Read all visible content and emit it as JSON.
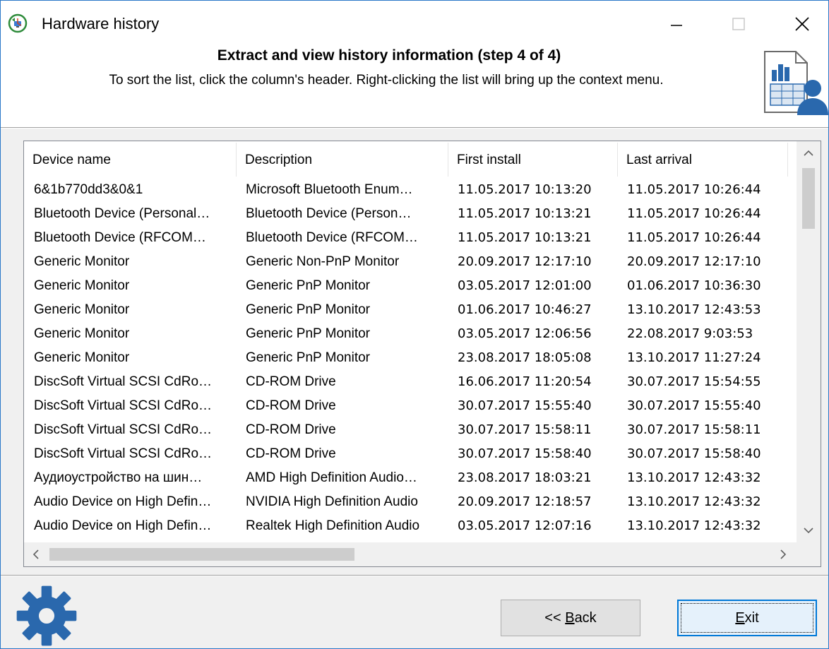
{
  "window": {
    "title": "Hardware history",
    "app_icon": "hardware-history-app-icon",
    "controls": [
      "minimize-icon",
      "maximize-icon",
      "close-icon"
    ]
  },
  "header": {
    "title": "Extract and view history information (step 4 of 4)",
    "subtitle": "To sort the list, click the column's header. Right-clicking the list will bring up the context menu.",
    "icon": "report-user-icon"
  },
  "list": {
    "columns": [
      "Device name",
      "Description",
      "First install",
      "Last arrival"
    ],
    "rows": [
      [
        "6&1b770dd3&0&1",
        "Microsoft Bluetooth Enum…",
        "11.05.2017 10:13:20",
        "11.05.2017 10:26:44"
      ],
      [
        "Bluetooth Device (Personal…",
        "Bluetooth Device (Person…",
        "11.05.2017 10:13:21",
        "11.05.2017 10:26:44"
      ],
      [
        "Bluetooth Device (RFCOM…",
        "Bluetooth Device (RFCOM…",
        "11.05.2017 10:13:21",
        "11.05.2017 10:26:44"
      ],
      [
        "Generic Monitor",
        "Generic Non-PnP Monitor",
        "20.09.2017 12:17:10",
        "20.09.2017 12:17:10"
      ],
      [
        "Generic Monitor",
        "Generic PnP Monitor",
        "03.05.2017 12:01:00",
        "01.06.2017 10:36:30"
      ],
      [
        "Generic Monitor",
        "Generic PnP Monitor",
        "01.06.2017 10:46:27",
        "13.10.2017 12:43:53"
      ],
      [
        "Generic Monitor",
        "Generic PnP Monitor",
        "03.05.2017 12:06:56",
        "22.08.2017 9:03:53"
      ],
      [
        "Generic Monitor",
        "Generic PnP Monitor",
        "23.08.2017 18:05:08",
        "13.10.2017 11:27:24"
      ],
      [
        "DiscSoft Virtual SCSI CdRo…",
        "CD-ROM Drive",
        "16.06.2017 11:20:54",
        "30.07.2017 15:54:55"
      ],
      [
        "DiscSoft Virtual SCSI CdRo…",
        "CD-ROM Drive",
        "30.07.2017 15:55:40",
        "30.07.2017 15:55:40"
      ],
      [
        "DiscSoft Virtual SCSI CdRo…",
        "CD-ROM Drive",
        "30.07.2017 15:58:11",
        "30.07.2017 15:58:11"
      ],
      [
        "DiscSoft Virtual SCSI CdRo…",
        "CD-ROM Drive",
        "30.07.2017 15:58:40",
        "30.07.2017 15:58:40"
      ],
      [
        "Аудиоустройство на шин…",
        "AMD High Definition Audio…",
        "23.08.2017 18:03:21",
        "13.10.2017 12:43:32"
      ],
      [
        "Audio Device on High Defin…",
        "NVIDIA High Definition Audio",
        "20.09.2017 12:18:57",
        "13.10.2017 12:43:32"
      ],
      [
        "Audio Device on High Defin…",
        "Realtek High Definition Audio",
        "03.05.2017 12:07:16",
        "13.10.2017 12:43:32"
      ]
    ]
  },
  "footer": {
    "icon": "gear-icon",
    "back_label": "<< Back",
    "exit_label": "Exit"
  },
  "colors": {
    "border_accent": "#2a78c8",
    "gear_blue": "#2a68ad",
    "focus_blue": "#0078d7"
  }
}
